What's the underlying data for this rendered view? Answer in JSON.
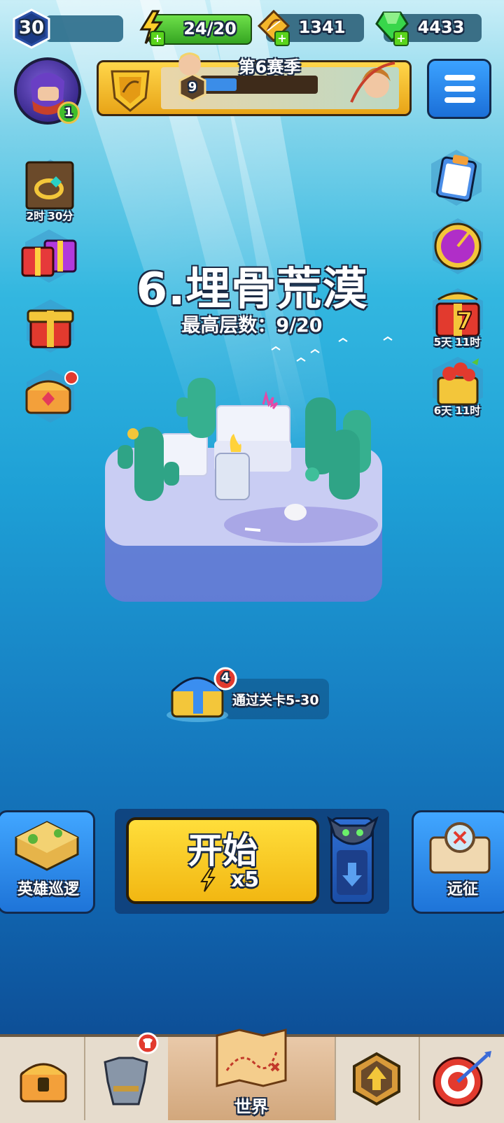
{
  "player": {
    "level": "30",
    "avatar_badge": "1"
  },
  "resources": {
    "energy": "24/20",
    "arrows": "1341",
    "gems": "4433"
  },
  "season": {
    "title": "第6赛季",
    "tier": "9",
    "progress_fraction": 0.3
  },
  "side_left": [
    {
      "icon": "ring-icon",
      "timer": "2时 30分"
    },
    {
      "icon": "gift-boxes-icon",
      "timer": ""
    },
    {
      "icon": "gift-box-icon",
      "timer": ""
    },
    {
      "icon": "treasure-chest-icon",
      "timer": ""
    }
  ],
  "side_right": [
    {
      "icon": "clipboard-icon",
      "timer": ""
    },
    {
      "icon": "spin-wheel-icon",
      "timer": ""
    },
    {
      "icon": "gift-7-icon",
      "timer": "5天 11时"
    },
    {
      "icon": "fruit-basket-icon",
      "timer": "6天 11时"
    }
  ],
  "stage": {
    "title": "6.埋骨荒漠",
    "best_floor": "最高层数：9/20"
  },
  "chest": {
    "badge": "4",
    "label": "通过关卡5-30"
  },
  "actions": {
    "left_label": "英雄巡逻",
    "start_label": "开始",
    "start_cost": "x5",
    "right_label": "远征"
  },
  "nav": {
    "items": [
      {
        "icon": "chest-icon",
        "label": ""
      },
      {
        "icon": "armor-icon",
        "label": ""
      },
      {
        "icon": "map-icon",
        "label": "世界"
      },
      {
        "icon": "upgrade-icon",
        "label": ""
      },
      {
        "icon": "target-icon",
        "label": ""
      }
    ]
  },
  "colors": {
    "accent_yellow": "#f2b712",
    "accent_blue": "#1e74d8",
    "energy_green": "#5ad41c",
    "gem_green": "#3fbe2c"
  }
}
